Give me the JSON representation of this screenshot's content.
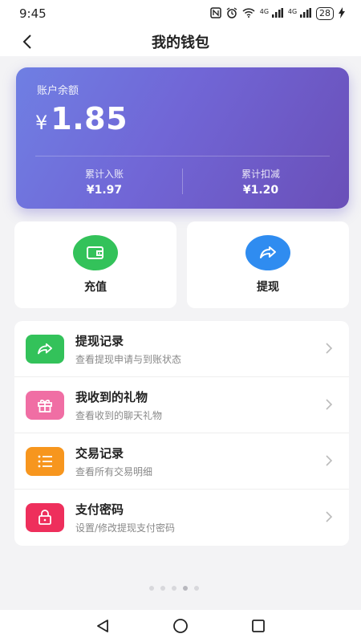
{
  "status_bar": {
    "time": "9:45",
    "icons": [
      "nfc-icon",
      "alarm-icon",
      "wifi-icon",
      "signal-4g-icon",
      "signal-4g-icon"
    ],
    "net_label_1": "4G",
    "net_label_2": "4G",
    "battery": "28"
  },
  "header": {
    "title": "我的钱包"
  },
  "balance_card": {
    "label": "账户余额",
    "currency": "¥",
    "amount": "1.85",
    "stats": [
      {
        "label": "累计入账",
        "value": "¥1.97"
      },
      {
        "label": "累计扣减",
        "value": "¥1.20"
      }
    ],
    "colors": {
      "gradient_start": "#6f7fe3",
      "gradient_end": "#6a4fb8"
    }
  },
  "actions": [
    {
      "label": "充值",
      "icon": "wallet-icon",
      "color": "#33c25a"
    },
    {
      "label": "提现",
      "icon": "share-arrow-icon",
      "color": "#2f8cf0"
    }
  ],
  "menu": [
    {
      "title": "提现记录",
      "subtitle": "查看提现申请与到账状态",
      "icon": "share-arrow-icon",
      "color": "#33c25a"
    },
    {
      "title": "我收到的礼物",
      "subtitle": "查看收到的聊天礼物",
      "icon": "gift-icon",
      "color": "#f06ea4"
    },
    {
      "title": "交易记录",
      "subtitle": "查看所有交易明细",
      "icon": "list-icon",
      "color": "#f7961e"
    },
    {
      "title": "支付密码",
      "subtitle": "设置/修改提现支付密码",
      "icon": "lock-icon",
      "color": "#ee2f5c"
    }
  ],
  "nav_bar": [
    "back-triangle-icon",
    "home-circle-icon",
    "recents-square-icon"
  ]
}
